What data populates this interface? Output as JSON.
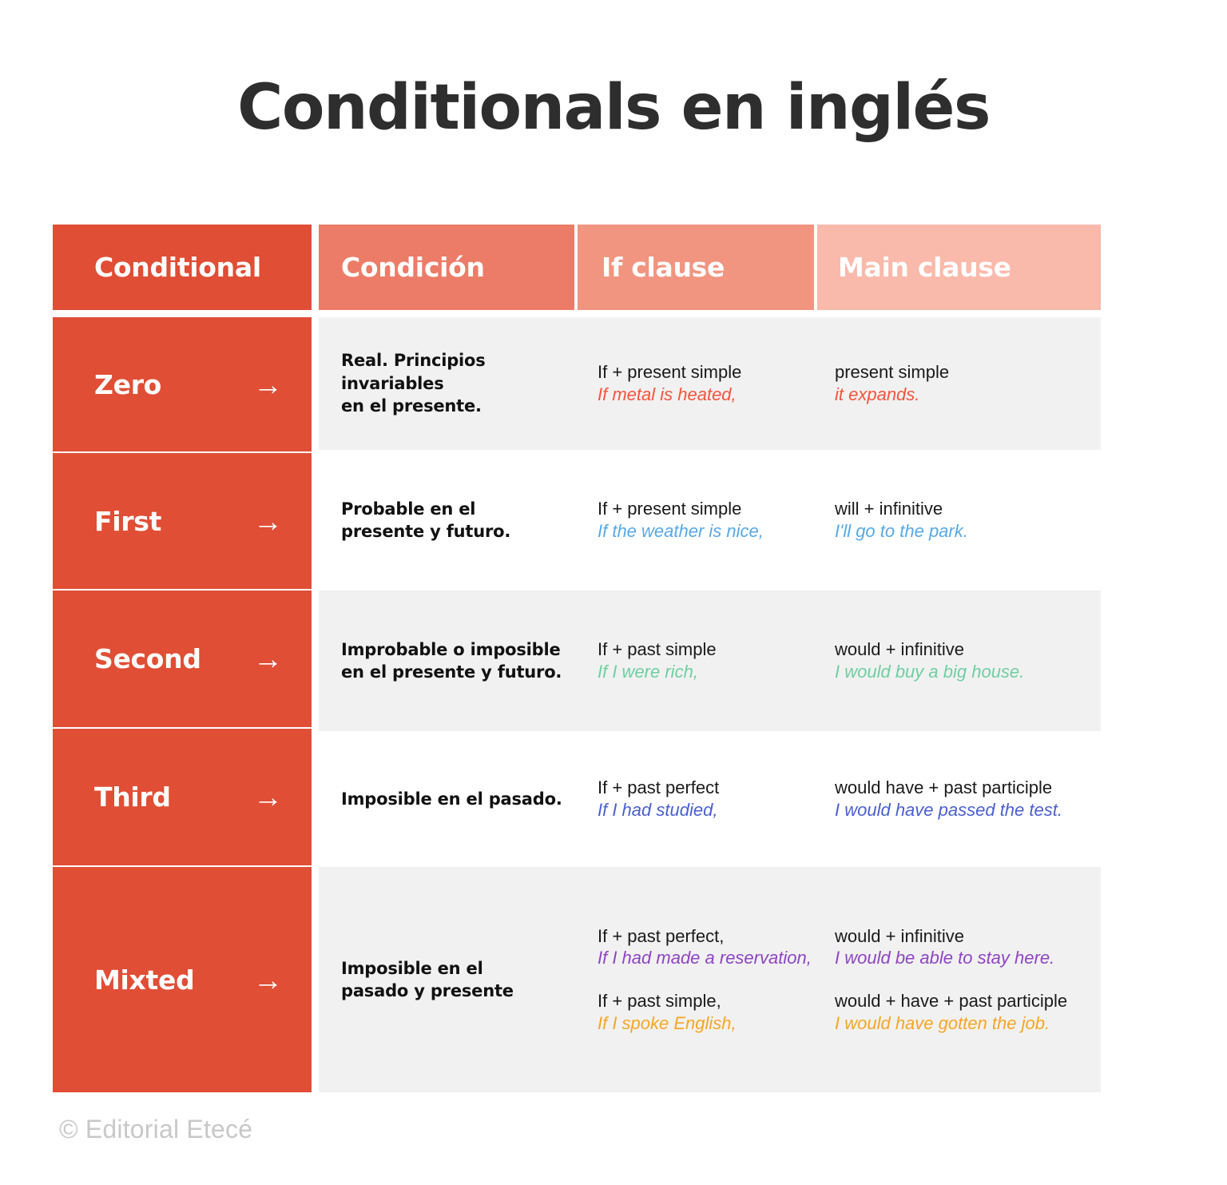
{
  "title": "Conditionals en inglés",
  "footer": "© Editorial Etecé",
  "colors": {
    "primary_red": "#e04e35",
    "header_2": "#ec7c68",
    "header_3": "#f19581",
    "header_4": "#f9b9ab",
    "row_stripe": "#f1f1f1",
    "zero_accent": "#f4543c",
    "first_accent": "#56a9e8",
    "second_accent": "#6ecfa0",
    "third_accent": "#4a5fd0",
    "mixed_accent_a": "#8e44c4",
    "mixed_accent_b": "#f5a623"
  },
  "headers": [
    {
      "label": "Conditional"
    },
    {
      "label": "Condición"
    },
    {
      "label": "If clause"
    },
    {
      "label": "Main clause"
    }
  ],
  "arrow_icon": "→",
  "rows": [
    {
      "name": "Zero",
      "condition_line1": "Real. Principios invariables",
      "condition_line2": "en el presente.",
      "if_formula": "If + present simple",
      "if_example": "If metal is heated,",
      "main_formula": "present simple",
      "main_example": "it expands.",
      "accent": "#f4543c"
    },
    {
      "name": "First",
      "condition_line1": "Probable en el",
      "condition_line2": "presente y futuro.",
      "if_formula": "If + present simple",
      "if_example": "If the weather is nice,",
      "main_formula": "will + infinitive",
      "main_example": "I'll go to the park.",
      "accent": "#56a9e8"
    },
    {
      "name": "Second",
      "condition_line1": "Improbable o imposible",
      "condition_line2": "en el presente y futuro.",
      "if_formula": "If + past simple",
      "if_example": "If I were rich,",
      "main_formula": "would + infinitive",
      "main_example": "I would buy a big house.",
      "accent": "#6ecfa0"
    },
    {
      "name": "Third",
      "condition_line1": "Imposible en el pasado.",
      "condition_line2": "",
      "if_formula": "If + past perfect",
      "if_example": "If I had studied,",
      "main_formula": "would have + past participle",
      "main_example": "I would have passed the test.",
      "accent": "#4a5fd0"
    },
    {
      "name": "Mixted",
      "condition_line1": "Imposible en el",
      "condition_line2": "pasado y presente",
      "if_formula": "If + past perfect,",
      "if_example": "If I had made a reservation,",
      "main_formula": "would + infinitive",
      "main_example": "I would be able to stay here.",
      "accent": "#8e44c4",
      "if_formula_2": "If + past simple,",
      "if_example_2": "If I spoke English,",
      "main_formula_2": "would + have + past participle",
      "main_example_2": "I would have gotten the job.",
      "accent_2": "#f5a623"
    }
  ]
}
